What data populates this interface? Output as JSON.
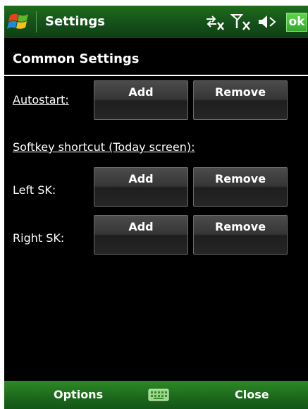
{
  "titlebar": {
    "title": "Settings",
    "ok_label": "ok",
    "icons": [
      "windows-start-icon",
      "connectivity-icon",
      "no-signal-icon",
      "speaker-muted-icon"
    ]
  },
  "section": {
    "title": "Common Settings"
  },
  "autostart": {
    "label": "Autostart:",
    "add_label": "Add",
    "remove_label": "Remove"
  },
  "softkey_shortcut": {
    "label": "Softkey shortcut (Today screen):"
  },
  "left_sk": {
    "label": "Left SK:",
    "add_label": "Add",
    "remove_label": "Remove"
  },
  "right_sk": {
    "label": "Right SK:",
    "add_label": "Add",
    "remove_label": "Remove"
  },
  "menubar": {
    "left_label": "Options",
    "right_label": "Close",
    "center_icon": "keyboard-icon"
  },
  "colors": {
    "titlebar": "#15521a",
    "menubar": "#1d6a1b",
    "ok_button": "#34a82c",
    "background": "#000000"
  }
}
